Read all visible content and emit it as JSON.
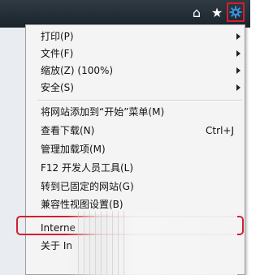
{
  "toolbar": {
    "home_icon": "home-icon",
    "favorites_icon": "star-icon",
    "tools_icon": "gear-icon",
    "highlight_color": "#d02030"
  },
  "menu": {
    "items": [
      {
        "label": "打印(P)",
        "has_submenu": true
      },
      {
        "label": "文件(F)",
        "has_submenu": true
      },
      {
        "label": "缩放(Z) (100%)",
        "has_submenu": true
      },
      {
        "label": "安全(S)",
        "has_submenu": true
      },
      {
        "label": "将网站添加到“开始”菜单(M)"
      },
      {
        "label": "查看下载(N)",
        "shortcut": "Ctrl+J"
      },
      {
        "label": "管理加载项(M)"
      },
      {
        "label": "F12 开发人员工具(L)"
      },
      {
        "label": "转到已固定的网站(G)"
      },
      {
        "label": "兼容性视图设置(B)"
      },
      {
        "label": "Interne"
      },
      {
        "label": "关于 In"
      }
    ]
  }
}
